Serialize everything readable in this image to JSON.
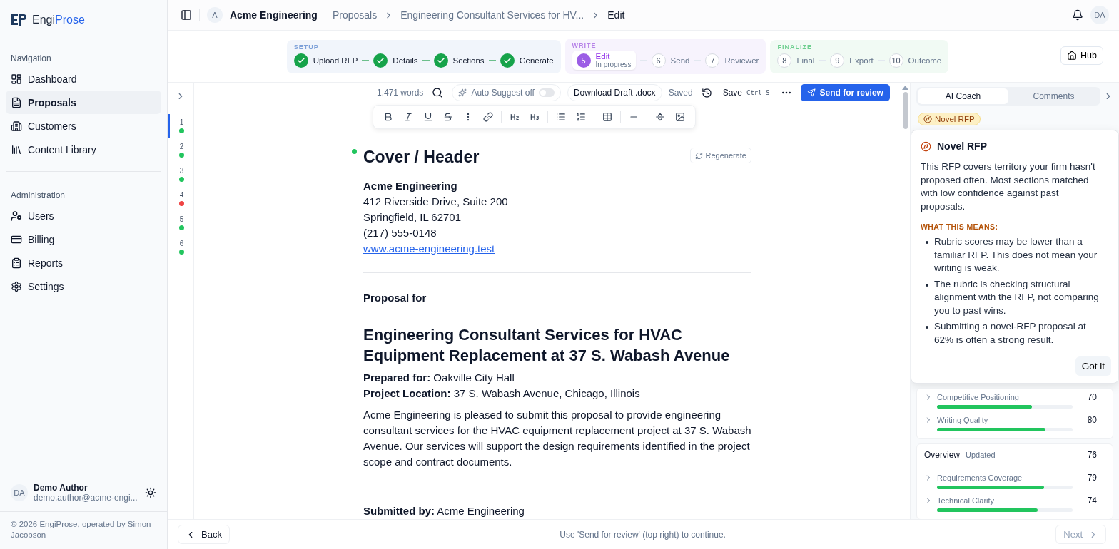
{
  "sidebar": {
    "brand": {
      "first": "Engi",
      "second": "Prose"
    },
    "groups": [
      {
        "title": "Navigation",
        "items": [
          {
            "label": "Dashboard",
            "selected": false
          },
          {
            "label": "Proposals",
            "selected": true
          },
          {
            "label": "Customers",
            "selected": false
          },
          {
            "label": "Content Library",
            "selected": false
          }
        ]
      },
      {
        "title": "Administration",
        "items": [
          {
            "label": "Users",
            "selected": false
          },
          {
            "label": "Billing",
            "selected": false
          },
          {
            "label": "Reports",
            "selected": false
          },
          {
            "label": "Settings",
            "selected": false
          }
        ]
      }
    ],
    "user": {
      "initials": "DA",
      "name": "Demo Author",
      "email": "demo.author@acme-engi..."
    },
    "copyright": "© 2026 EngiProse, operated by Simon Jacobson"
  },
  "topbar": {
    "org_initial": "A",
    "org": "Acme Engineering",
    "breadcrumbs": [
      "Proposals",
      "Engineering Consultant Services for HV...",
      "Edit"
    ],
    "user_initials": "DA"
  },
  "stepper": {
    "groups": [
      {
        "title": "SETUP",
        "kind": "setup",
        "steps": [
          {
            "label": "Upload RFP",
            "completed": true,
            "selected": false
          },
          {
            "label": "Details",
            "completed": true,
            "selected": false
          },
          {
            "label": "Sections",
            "completed": true,
            "selected": false
          },
          {
            "label": "Generate",
            "completed": true,
            "selected": false
          }
        ]
      },
      {
        "title": "WRITE",
        "kind": "write",
        "steps": [
          {
            "number": "5",
            "label": "Edit",
            "sub": "In progress",
            "completed": false,
            "selected": true
          },
          {
            "number": "6",
            "label": "Send",
            "completed": false,
            "selected": false
          },
          {
            "number": "7",
            "label": "Reviewer",
            "completed": false,
            "selected": false
          }
        ]
      },
      {
        "title": "FINALIZE",
        "kind": "finalize",
        "steps": [
          {
            "number": "8",
            "label": "Final",
            "completed": false,
            "selected": false
          },
          {
            "number": "9",
            "label": "Export",
            "completed": false,
            "selected": false
          },
          {
            "number": "10",
            "label": "Outcome",
            "completed": false,
            "selected": false
          }
        ]
      }
    ],
    "hub": "Hub"
  },
  "sections": [
    {
      "number": "1",
      "color": "#22c55e",
      "selected": true
    },
    {
      "number": "2",
      "color": "#22c55e",
      "selected": false
    },
    {
      "number": "3",
      "color": "#22c55e",
      "selected": false
    },
    {
      "number": "4",
      "color": "#ef4444",
      "selected": false
    },
    {
      "number": "5",
      "color": "#22c55e",
      "selected": false
    },
    {
      "number": "6",
      "color": "#22c55e",
      "selected": false
    }
  ],
  "editor_toolbar": {
    "word_count": "1,471 words",
    "auto_suggest": {
      "label": "Auto Suggest off",
      "on": false
    },
    "download": "Download Draft .docx",
    "status": "Saved",
    "save": "Save",
    "save_shortcut": "Ctrl+S",
    "send": "Send for review"
  },
  "format_tools": [
    {
      "kind": "bold"
    },
    {
      "kind": "italic"
    },
    {
      "kind": "underline"
    },
    {
      "kind": "strike"
    },
    {
      "kind": "more"
    },
    {
      "kind": "link"
    },
    {
      "kind": "h2"
    },
    {
      "kind": "h3"
    },
    {
      "kind": "bullets"
    },
    {
      "kind": "numbered"
    },
    {
      "kind": "table"
    },
    {
      "kind": "rule"
    },
    {
      "kind": "pagebreak"
    },
    {
      "kind": "image"
    }
  ],
  "document": {
    "section_title": "Cover / Header",
    "regenerate": "Regenerate",
    "company": "Acme Engineering",
    "address": [
      "412 Riverside Drive, Suite 200",
      "Springfield, IL 62701",
      "(217) 555-0148"
    ],
    "website": "www.acme-engineering.test",
    "proposal_for": "Proposal for",
    "title": "Engineering Consultant Services for HVAC Equipment Replacement at 37 S. Wabash Avenue",
    "details": [
      "**Prepared for:** Oakville City Hall",
      "**Project Location:** 37 S. Wabash Avenue, Chicago, Illinois"
    ],
    "paragraph": "Acme Engineering is pleased to submit this proposal to provide engineering consultant services for the HVAC equipment replacement project at 37 S. Wabash Avenue. Our services will support the design requirements identified in the project scope and contract documents.",
    "submitted": "**Submitted by:** Acme Engineering"
  },
  "panel": {
    "tabs": [
      {
        "label": "AI Coach",
        "selected": true
      },
      {
        "label": "Comments",
        "selected": false
      }
    ],
    "badge": "Novel RFP",
    "popover": {
      "title": "Novel RFP",
      "body": "This RFP covers territory your firm hasn't proposed often. Most sections matched with low confidence against past proposals.",
      "subheading": "WHAT THIS MEANS:",
      "bullets": [
        "Rubric scores may be lower than a familiar RFP. This does not mean your writing is weak.",
        "The rubric is checking structural alignment with the RFP, not comparing you to past wins.",
        "Submitting a novel-RFP proposal at 62% is often a strong result."
      ],
      "button": "Got it"
    },
    "score_cards": [
      {
        "items": [
          {
            "label": "Competitive Positioning",
            "score": "70",
            "level": 0.7
          },
          {
            "label": "Writing Quality",
            "score": "80",
            "level": 0.8
          }
        ]
      },
      {
        "title": "Overview",
        "tag": "Updated",
        "score": "76",
        "items": [
          {
            "label": "Requirements Coverage",
            "score": "79",
            "level": 0.79
          },
          {
            "label": "Technical Clarity",
            "score": "74",
            "level": 0.74
          }
        ]
      }
    ]
  },
  "footer": {
    "back": "Back",
    "hint": "Use 'Send for review' (top right) to continue.",
    "next": "Next",
    "next_disabled": true
  }
}
